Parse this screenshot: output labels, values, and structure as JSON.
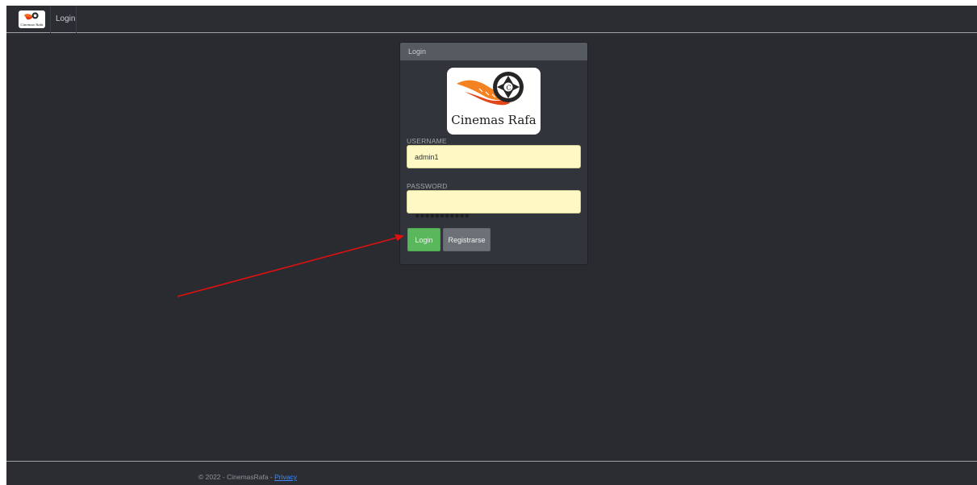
{
  "navbar": {
    "logo_text": "Cinemas Rafa",
    "login_link": "Login"
  },
  "panel": {
    "title": "Login",
    "brand": "Cinemas Rafa",
    "username_label": "USERNAME",
    "username_value": "admin1",
    "password_label": "PASSWORD",
    "password_mask": "●●●●●●●●●●●",
    "login_button": "Login",
    "register_button": "Registrarse"
  },
  "footer": {
    "prefix": "© 2022 - CinemasRafa - ",
    "privacy_link": "Privacy"
  },
  "colors": {
    "background": "#292b31",
    "panel_header": "#565a61",
    "input_bg": "#fdf8c4",
    "login_green": "#5bb75b",
    "register_gray": "#6c7178",
    "arrow_red": "#e01010",
    "link_blue": "#3d8bfd"
  }
}
